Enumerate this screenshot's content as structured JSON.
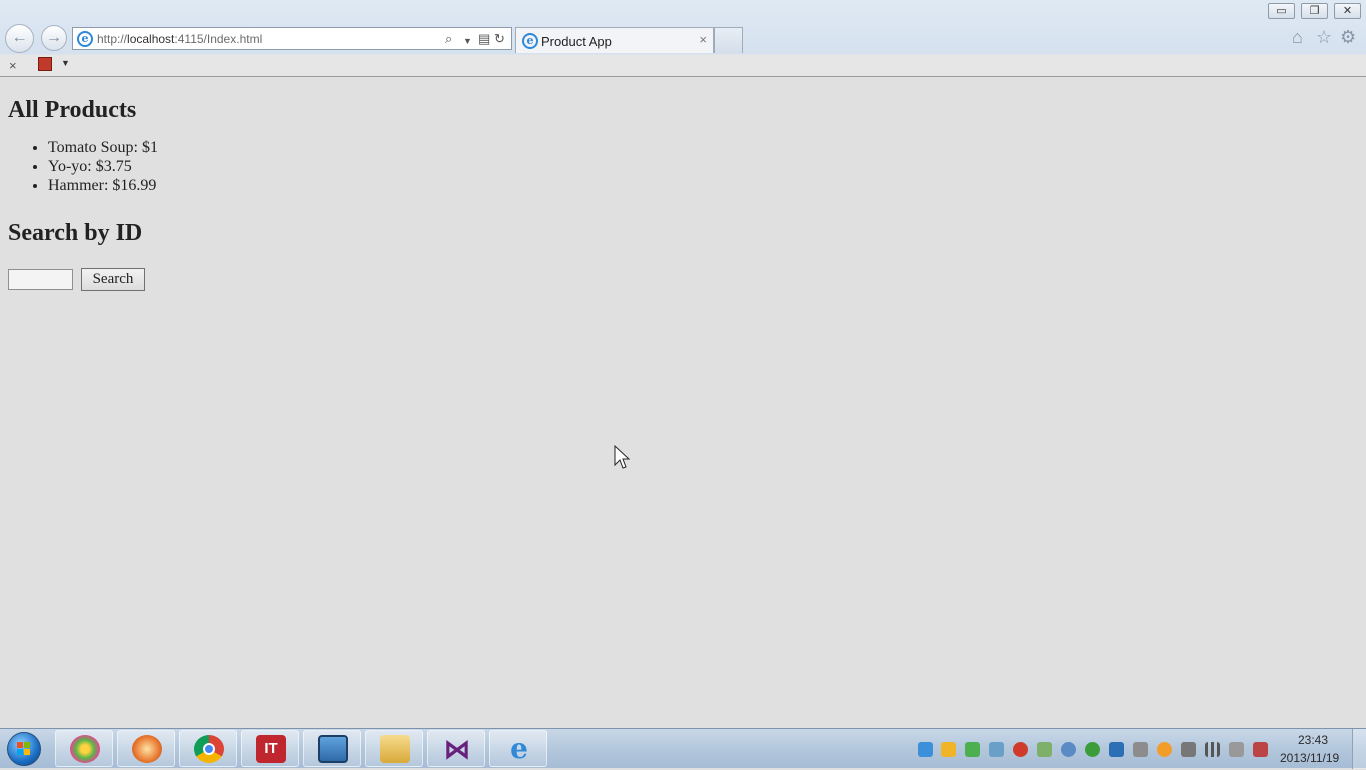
{
  "browser": {
    "window_controls": {
      "minimize": "▭",
      "restore": "❐",
      "close": "✕"
    },
    "address": {
      "prefix": "http://",
      "host": "localhost",
      "rest": ":4115/Index.html"
    },
    "tab": {
      "title": "Product App",
      "close_label": "×"
    },
    "command_bar": {
      "close_label": "×"
    }
  },
  "page": {
    "heading": "All Products",
    "products": [
      "Tomato Soup: $1",
      "Yo-yo: $3.75",
      "Hammer: $16.99"
    ],
    "search_heading": "Search by ID",
    "search_value": "",
    "search_button": "Search"
  },
  "taskbar": {
    "time": "23:43",
    "date": "2013/11/19",
    "pinned": [
      {
        "name": "pinwheel-app-icon",
        "color": "#5ab54a"
      },
      {
        "name": "rocket-app-icon",
        "color": "#e8772e"
      },
      {
        "name": "chrome-icon",
        "color": "#db4437"
      },
      {
        "name": "it-app-icon",
        "color": "#c0262d"
      },
      {
        "name": "monitor-app-icon",
        "color": "#3a7bbf"
      },
      {
        "name": "folder-icon",
        "color": "#e8c05a"
      },
      {
        "name": "visual-studio-icon",
        "color": "#68217a"
      },
      {
        "name": "internet-explorer-icon",
        "color": "#2f88d8"
      }
    ]
  }
}
